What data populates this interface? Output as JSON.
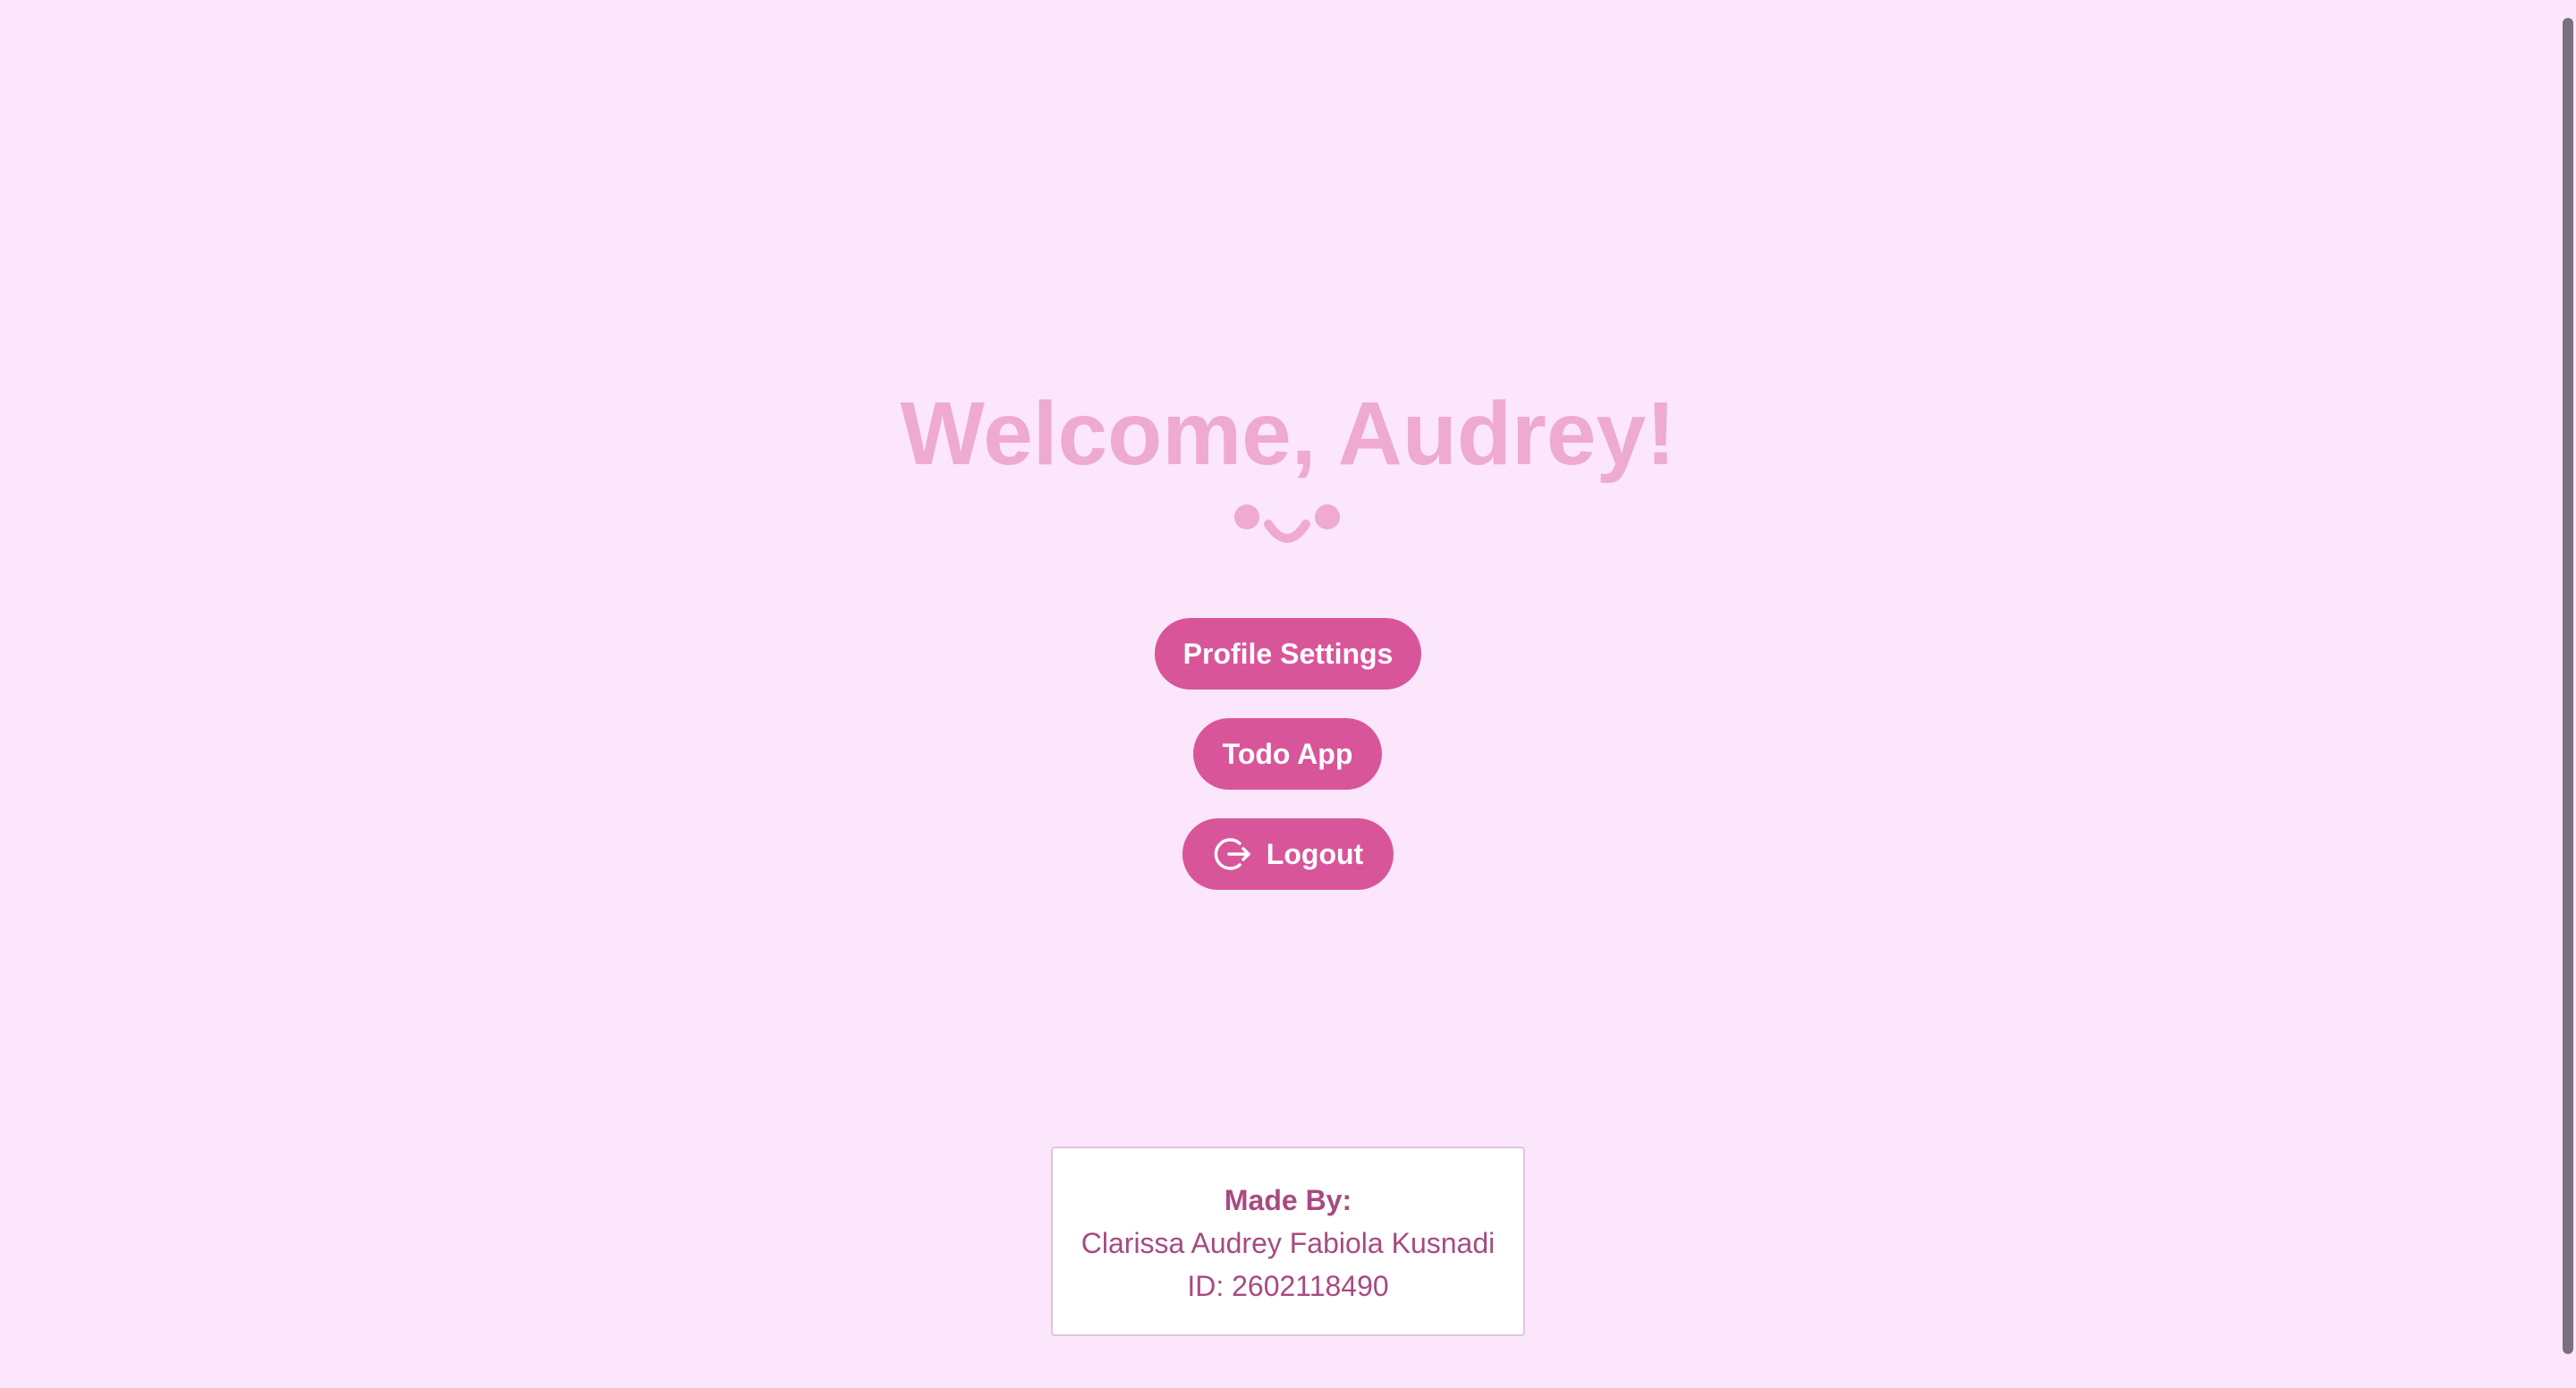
{
  "welcome": {
    "title": "Welcome, Audrey!"
  },
  "face": {
    "icon": "smiley-face-icon"
  },
  "buttons": {
    "profile_settings": "Profile Settings",
    "todo_app": "Todo App",
    "logout": "Logout",
    "logout_icon": "logout-icon"
  },
  "footer": {
    "made_by": "Made By:",
    "name": "Clarissa Audrey Fabiola Kusnadi",
    "id": "ID: 2602118490"
  },
  "colors": {
    "background": "#fbe6fb",
    "title": "#eeaad0",
    "button": "#d9559a",
    "footer_text": "#a84a82",
    "scrollbar": "#79707b"
  }
}
